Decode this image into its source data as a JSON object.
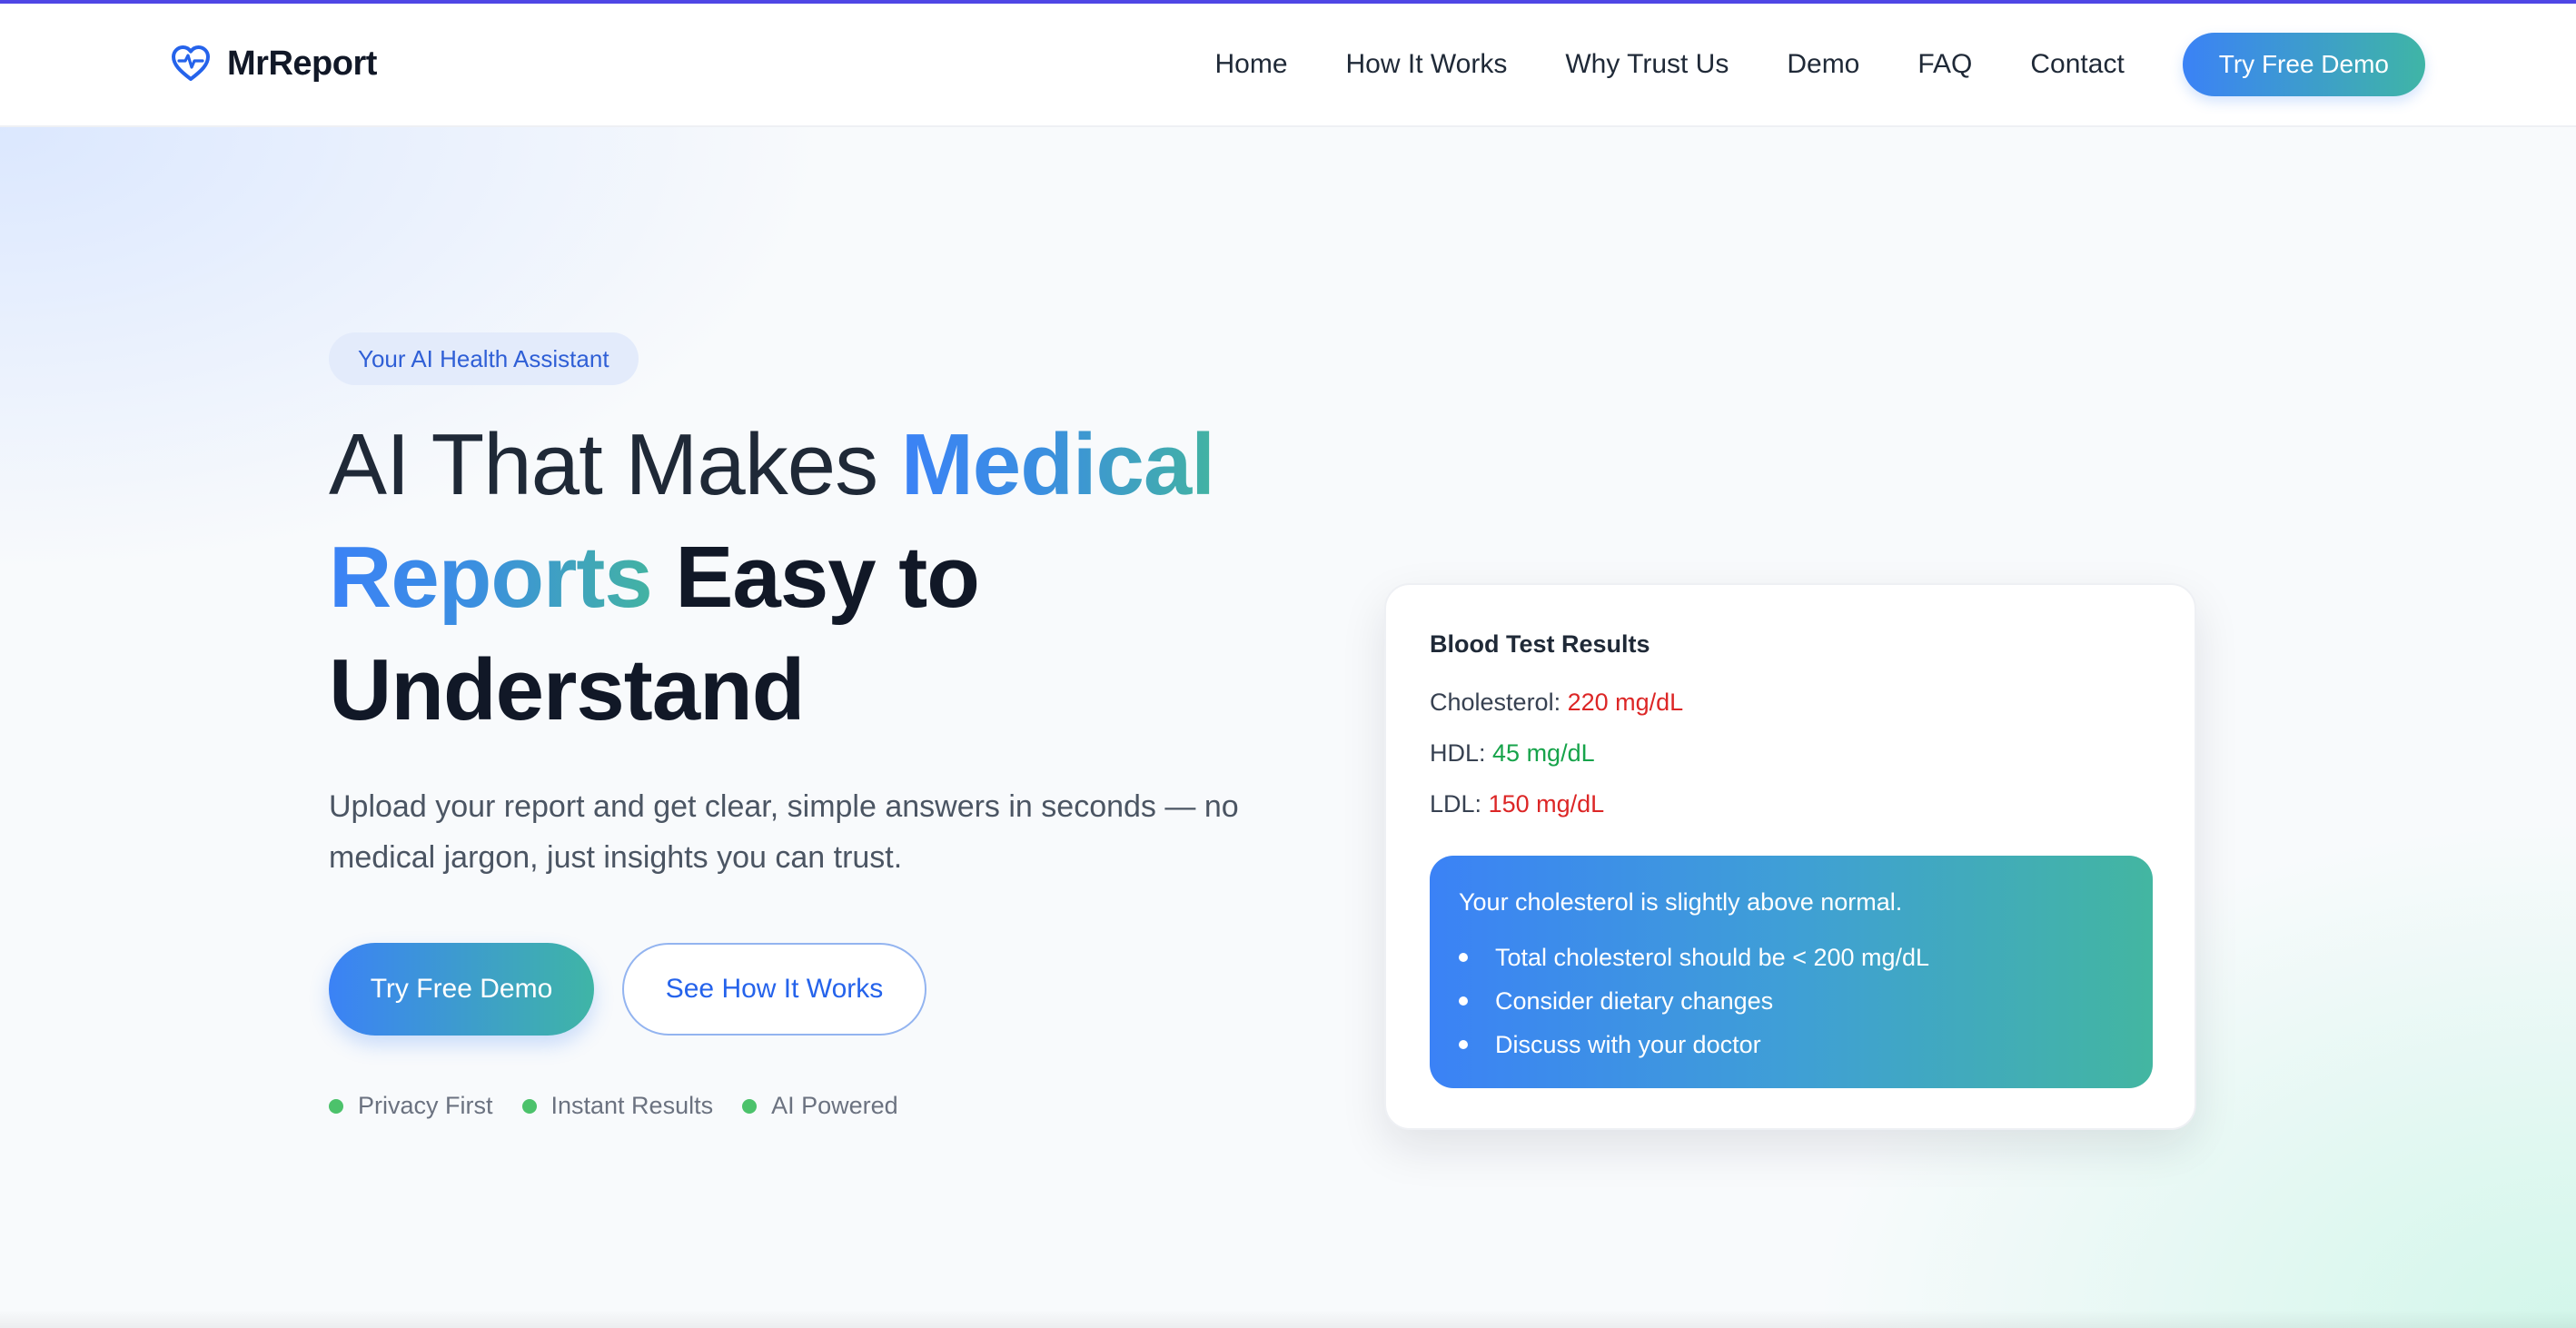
{
  "brand": {
    "name": "MrReport",
    "icon": "heart-pulse-icon",
    "accent": "#3b82f6",
    "accent_end": "#3fb5a6"
  },
  "nav": {
    "items": [
      "Home",
      "How It Works",
      "Why Trust Us",
      "Demo",
      "FAQ",
      "Contact"
    ],
    "cta": "Try Free Demo"
  },
  "hero": {
    "badge": "Your AI Health Assistant",
    "headline": {
      "part1": "AI That Makes ",
      "highlight1": "Medical",
      "highlight2": "Reports",
      "part2": " Easy to",
      "part3": "Understand"
    },
    "subtitle": "Upload your report and get clear, simple answers in seconds — no medical jargon, just insights you can trust.",
    "primary_button": "Try Free Demo",
    "secondary_button": "See How It Works",
    "features": [
      "Privacy First",
      "Instant Results",
      "AI Powered"
    ]
  },
  "card": {
    "title": "Blood Test Results",
    "rows": [
      {
        "label": "Cholesterol:",
        "value": "220 mg/dL",
        "status": "high"
      },
      {
        "label": "HDL:",
        "value": "45 mg/dL",
        "status": "normal"
      },
      {
        "label": "LDL:",
        "value": "150 mg/dL",
        "status": "high"
      }
    ],
    "insight": {
      "title": "Your cholesterol is slightly above normal.",
      "bullets": [
        "Total cholesterol should be < 200 mg/dL",
        "Consider dietary changes",
        "Discuss with your doctor"
      ]
    }
  }
}
